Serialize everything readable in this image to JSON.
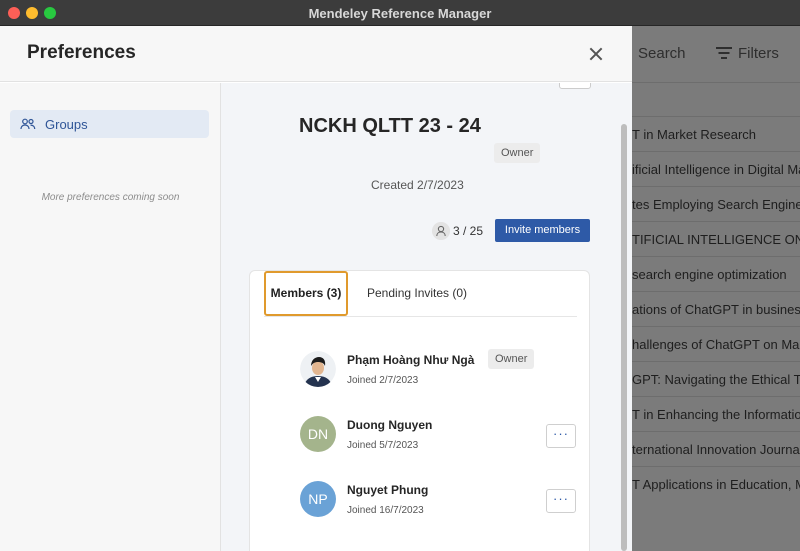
{
  "window": {
    "title": "Mendeley Reference Manager"
  },
  "background": {
    "search_label": "Search",
    "filters_label": "Filters",
    "rows": [
      "T in Market Research",
      "ificial Intelligence in Digital Mar",
      "tes Employing Search Engine (",
      "TIFICIAL INTELLIGENCE ON S",
      "search engine optimization",
      "ations of ChatGPT in business",
      "hallenges of ChatGPT on Mark",
      "GPT: Navigating the Ethical Terr",
      "T in Enhancing the Information S",
      "ternational Innovation Journal (",
      "T Applications in Education, Ma"
    ]
  },
  "modal": {
    "title": "Preferences",
    "sidebar": {
      "items": [
        {
          "label": "Groups",
          "icon": "users-icon"
        }
      ],
      "note": "More preferences coming soon"
    },
    "group": {
      "name": "NCKH QLTT 23 - 24",
      "role_badge": "Owner",
      "created": "Created 2/7/2023",
      "member_count": "3 / 25",
      "invite_label": "Invite members"
    },
    "tabs": [
      {
        "label": "Members (3)",
        "active": true
      },
      {
        "label": "Pending Invites (0)",
        "active": false
      }
    ],
    "members": [
      {
        "name": "Phạm Hoàng Như Ngà",
        "joined": "Joined 2/7/2023",
        "badge": "Owner",
        "initials": ""
      },
      {
        "name": "Duong Nguyen",
        "joined": "Joined 5/7/2023",
        "initials": "DN",
        "more": "···"
      },
      {
        "name": "Nguyet Phung",
        "joined": "Joined 16/7/2023",
        "initials": "NP",
        "more": "···"
      }
    ]
  },
  "colors": {
    "accent": "#2e5aa7",
    "tab_highlight": "#e09a2d",
    "sidebar_selected": "#e3eaf4"
  }
}
